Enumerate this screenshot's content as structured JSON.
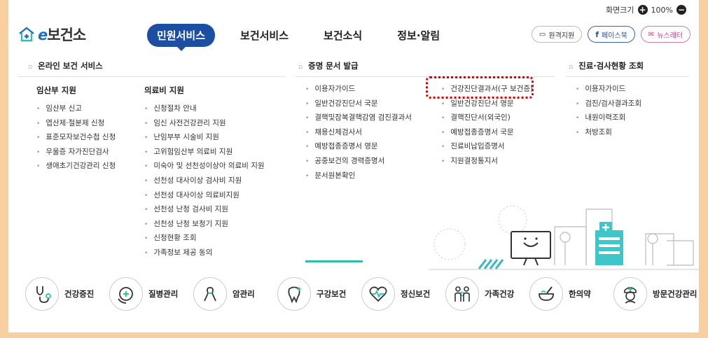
{
  "util": {
    "label": "화면크기",
    "zoom": "100%",
    "plus": "+",
    "minus": "−"
  },
  "logo": {
    "e": "e",
    "text": "보건소"
  },
  "gnb": [
    {
      "label": "민원서비스",
      "active": true
    },
    {
      "label": "보건서비스",
      "active": false
    },
    {
      "label": "보건소식",
      "active": false
    },
    {
      "label": "정보·알림",
      "active": false
    }
  ],
  "header_buttons": {
    "remote": "원격지원",
    "facebook_f": "f",
    "facebook": "페이스북",
    "newsletter": "뉴스레터"
  },
  "sections": {
    "online": "온라인 보건 서비스",
    "certificate": "증명 문서 발급",
    "result": "진료·검사현황 조회"
  },
  "pregnancy": {
    "title": "임산부 지원",
    "items": [
      "임산부 신고",
      "엽산제·철분제 신청",
      "표준모자보건수첩 신청",
      "우울증 자가진단검사",
      "생애초기건강관리 신청"
    ]
  },
  "medical": {
    "title": "의료비 지원",
    "items": [
      "신청절차 안내",
      "임신 사전건강관리 지원",
      "난임부부 시술비 지원",
      "고위험임산부 의료비 지원",
      "미숙아 및 선천성이상아 의료비 지원",
      "선천성 대사이상 검사비 지원",
      "선천성 대사이상 의료비지원",
      "선천성 난청 검사비 지원",
      "선천성 난청 보청기 지원",
      "신청현황 조회",
      "가족정보 제공 동의"
    ]
  },
  "cert_left": [
    "이용자가이드",
    "일반건강진단서 국문",
    "결핵및잠복결핵감염 검진결과서",
    "채용신체검사서",
    "예방접종증명서 영문",
    "공중보건의 경력증명서",
    "문서원본확인"
  ],
  "cert_right": [
    "건강진단결과서(구 보건증)",
    "일반건강진단서 영문",
    "결핵진단서(외국인)",
    "예방접종증명서 국문",
    "진료비납입증명서",
    "지원결정통지서"
  ],
  "result_items": [
    "이용자가이드",
    "검진/검사결과조회",
    "내원이력조회",
    "처방조회"
  ],
  "bottom": {
    "heading": "",
    "icons": [
      {
        "label": "건강증진",
        "icon": "stethoscope-icon"
      },
      {
        "label": "질병관리",
        "icon": "virus-care-icon"
      },
      {
        "label": "암관리",
        "icon": "ribbon-icon"
      },
      {
        "label": "구강보건",
        "icon": "tooth-icon"
      },
      {
        "label": "정신보건",
        "icon": "heartbeat-icon"
      },
      {
        "label": "가족건강",
        "icon": "family-icon"
      },
      {
        "label": "한의약",
        "icon": "mortar-icon"
      },
      {
        "label": "방문건강관리",
        "icon": "nurse-icon"
      }
    ]
  },
  "colors": {
    "accent": "#1c4fa3",
    "highlight": "#dd0000",
    "teal": "#2ec0a8"
  }
}
